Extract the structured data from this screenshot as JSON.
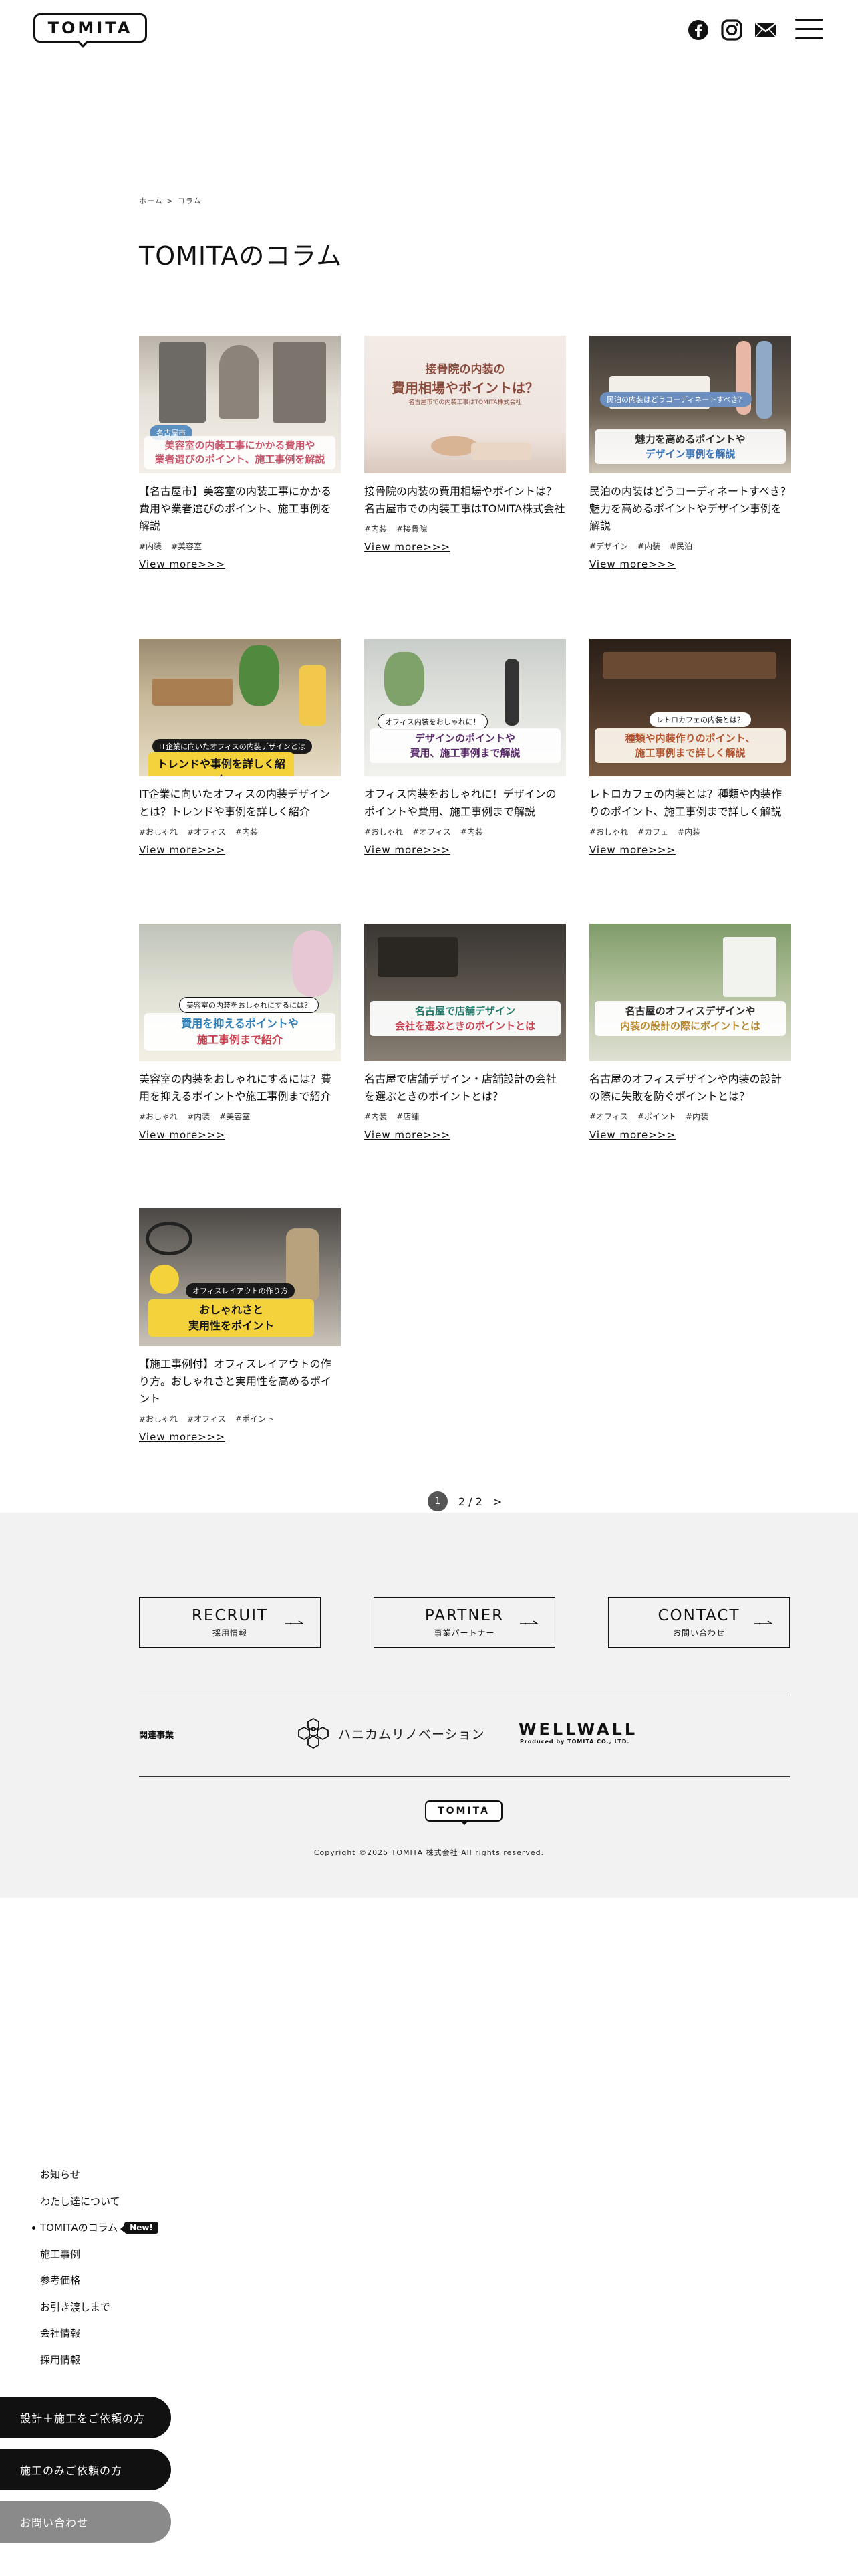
{
  "header": {
    "logo_text": "TOMITA",
    "icons": [
      "facebook-icon",
      "instagram-icon",
      "mail-icon",
      "hamburger-menu-icon"
    ]
  },
  "breadcrumb": [
    "ホーム",
    "コラム"
  ],
  "page_title": "TOMITAのコラム",
  "cards": [
    {
      "title": "【名古屋市】美容室の内装工事にかかる費用や業者選びのポイント、施工事例を解説",
      "tags": [
        "#内装",
        "#美容室"
      ],
      "more": "View more>>>",
      "thumb": {
        "lines": [
          "美容室の内装工事にかかる費用や",
          "業者選びのポイント、施工事例を解説"
        ],
        "label": "名古屋市"
      }
    },
    {
      "title": "接骨院の内装の費用相場やポイントは？名古屋市での内装工事はTOMITA株式会社",
      "tags": [
        "#内装",
        "#接骨院"
      ],
      "more": "View more>>>",
      "thumb": {
        "lines": [
          "接骨院の内装の",
          "費用相場やポイントは？"
        ],
        "label": "名古屋市での内装工事はTOMITA株式会社"
      }
    },
    {
      "title": "民泊の内装はどうコーディネートすべき？魅力を高めるポイントやデザイン事例を解説",
      "tags": [
        "#デザイン",
        "#内装",
        "#民泊"
      ],
      "more": "View more>>>",
      "thumb": {
        "lines": [
          "魅力を高めるポイントや",
          "デザイン事例を解説"
        ],
        "label": "民泊の内装はどうコーディネートすべき？"
      }
    },
    {
      "title": "IT企業に向いたオフィスの内装デザインとは？トレンドや事例を詳しく紹介",
      "tags": [
        "#おしゃれ",
        "#オフィス",
        "#内装"
      ],
      "more": "View more>>>",
      "thumb": {
        "lines": [
          "トレンドや事例を詳しく紹介"
        ],
        "label": "IT企業に向いたオフィスの内装デザインとは"
      }
    },
    {
      "title": "オフィス内装をおしゃれに！デザインのポイントや費用、施工事例まで解説",
      "tags": [
        "#おしゃれ",
        "#オフィス",
        "#内装"
      ],
      "more": "View more>>>",
      "thumb": {
        "lines": [
          "デザインのポイントや",
          "費用、施工事例まで解説"
        ],
        "label": "オフィス内装をおしゃれに！"
      }
    },
    {
      "title": "レトロカフェの内装とは？種類や内装作りのポイント、施工事例まで詳しく解説",
      "tags": [
        "#おしゃれ",
        "#カフェ",
        "#内装"
      ],
      "more": "View more>>>",
      "thumb": {
        "lines": [
          "種類や内装作りのポイント、",
          "施工事例まで詳しく解説"
        ],
        "label": "レトロカフェの内装とは？"
      }
    },
    {
      "title": "美容室の内装をおしゃれにするには？費用を抑えるポイントや施工事例まで紹介",
      "tags": [
        "#おしゃれ",
        "#内装",
        "#美容室"
      ],
      "more": "View more>>>",
      "thumb": {
        "lines": [
          "費用を抑えるポイントや",
          "施工事例まで紹介"
        ],
        "label": "美容室の内装をおしゃれにするには？"
      }
    },
    {
      "title": "名古屋で店舗デザイン・店舗設計の会社を選ぶときのポイントとは？",
      "tags": [
        "#内装",
        "#店舗"
      ],
      "more": "View more>>>",
      "thumb": {
        "lines": [
          "名古屋で店舗デザイン",
          "会社を選ぶときのポイントとは"
        ],
        "label": ""
      }
    },
    {
      "title": "名古屋のオフィスデザインや内装の設計の際に失敗を防ぐポイントとは？",
      "tags": [
        "#オフィス",
        "#ポイント",
        "#内装"
      ],
      "more": "View more>>>",
      "thumb": {
        "lines": [
          "名古屋のオフィスデザインや",
          "内装の設計の際にポイントとは"
        ],
        "label": ""
      }
    },
    {
      "title": "【施工事例付】オフィスレイアウトの作り方。おしゃれさと実用性を高めるポイント",
      "tags": [
        "#おしゃれ",
        "#オフィス",
        "#ポイント"
      ],
      "more": "View more>>>",
      "thumb": {
        "lines": [
          "おしゃれさと",
          "実用性をポイント"
        ],
        "label": "オフィスレイアウトの作り方"
      }
    }
  ],
  "pagination": {
    "current": "1",
    "total": "2 / 2",
    "next": ">"
  },
  "footer": {
    "buttons": [
      {
        "en": "RECRUIT",
        "ja": "採用情報"
      },
      {
        "en": "PARTNER",
        "ja": "事業パートナー"
      },
      {
        "en": "CONTACT",
        "ja": "お問い合わせ"
      }
    ],
    "related_label": "関連事業",
    "honeycomb_text": "ハニカムリノベーション",
    "wellwall_title": "WELLWALL",
    "wellwall_sub": "Produced by TOMITA CO., LTD.",
    "logo_text": "TOMITA",
    "copyright": "Copyright ©2025 TOMITA 株式会社 All rights reserved."
  },
  "side_menu": {
    "items": [
      "お知らせ",
      "わたし達について",
      "TOMITAのコラム",
      "施工事例",
      "参考価格",
      "お引き渡しまで",
      "会社情報",
      "採用情報"
    ],
    "active": "TOMITAのコラム",
    "new_badge": "New!"
  },
  "cta_buttons": [
    {
      "label": "設計＋施工をご依頼の方",
      "color": "#111111"
    },
    {
      "label": "施工のみご依頼の方",
      "color": "#111111"
    },
    {
      "label": "お問い合わせ",
      "color": "#8a8a8a"
    }
  ]
}
